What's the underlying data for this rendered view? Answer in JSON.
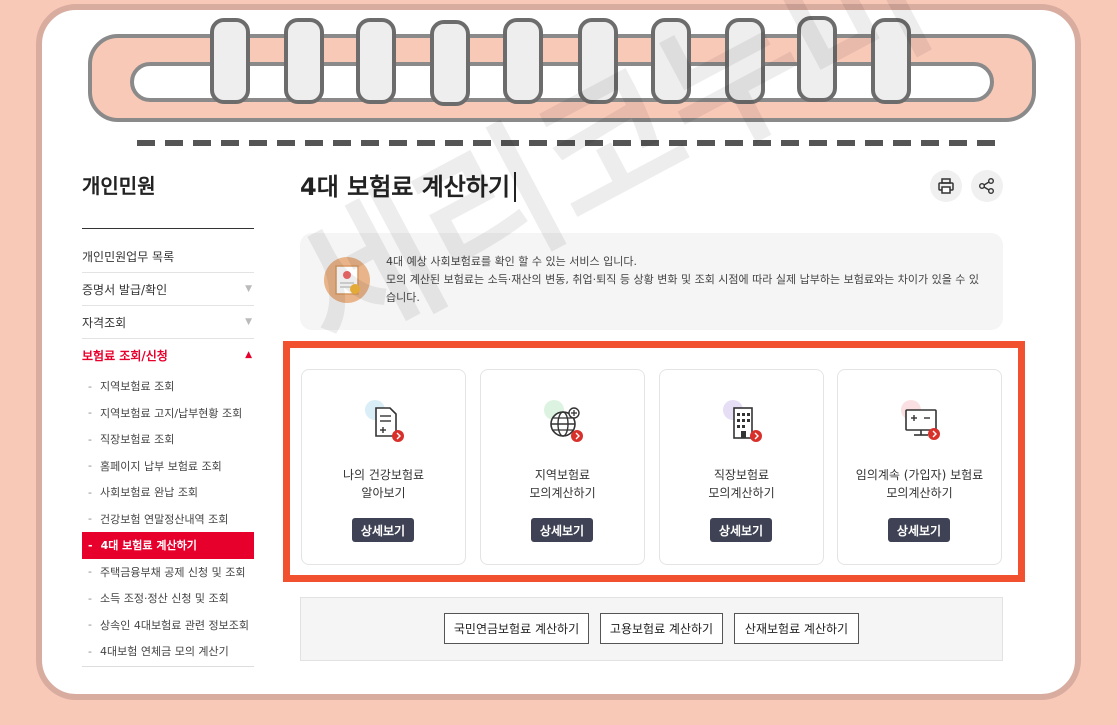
{
  "colors": {
    "accent": "#e8002d",
    "highlight": "#f25130",
    "button_dark": "#3f4254",
    "page_bg": "#f9c9b8"
  },
  "sidebar": {
    "title": "개인민원",
    "items": [
      {
        "label": "개인민원업무 목록"
      },
      {
        "label": "증명서 발급/확인",
        "arrow": "▼"
      },
      {
        "label": "자격조회",
        "arrow": "▼"
      },
      {
        "label": "보험료 조회/신청",
        "arrow": "▲"
      }
    ],
    "sub_items": [
      "지역보험료 조회",
      "지역보험료 고지/납부현황 조회",
      "직장보험료 조회",
      "홈페이지 납부 보험료 조회",
      "사회보험료 완납 조회",
      "건강보험 연말정산내역 조회",
      "4대 보험료 계산하기",
      "주택금융부채 공제 신청 및 조회",
      "소득 조정·정산 신청 및 조회",
      "상속인 4대보험료 관련 정보조회",
      "4대보험 연체금 모의 계산기"
    ]
  },
  "main": {
    "title": "4대 보험료 계산하기",
    "notice": {
      "line1": "4대 예상 사회보험료를 확인 할 수 있는 서비스 입니다.",
      "line2": "모의 계산된 보험료는 소득·재산의 변동, 취업·퇴직 등 상황 변화 및 조회 시점에 따라 실제 납부하는 보험료와는 차이가 있을 수 있습니다."
    },
    "services": [
      {
        "label": "나의 건강보험료\n알아보기",
        "button": "상세보기",
        "icon": "document-plus-icon"
      },
      {
        "label": "지역보험료\n모의계산하기",
        "button": "상세보기",
        "icon": "globe-plus-icon"
      },
      {
        "label": "직장보험료\n모의계산하기",
        "button": "상세보기",
        "icon": "building-icon"
      },
      {
        "label": "임의계속 (가입자) 보험료\n모의계산하기",
        "button": "상세보기",
        "icon": "calculator-monitor-icon"
      }
    ],
    "calc_buttons": [
      "국민연금보험료 계산하기",
      "고용보험료 계산하기",
      "산재보험료 계산하기"
    ]
  },
  "watermark": "세리코누미"
}
